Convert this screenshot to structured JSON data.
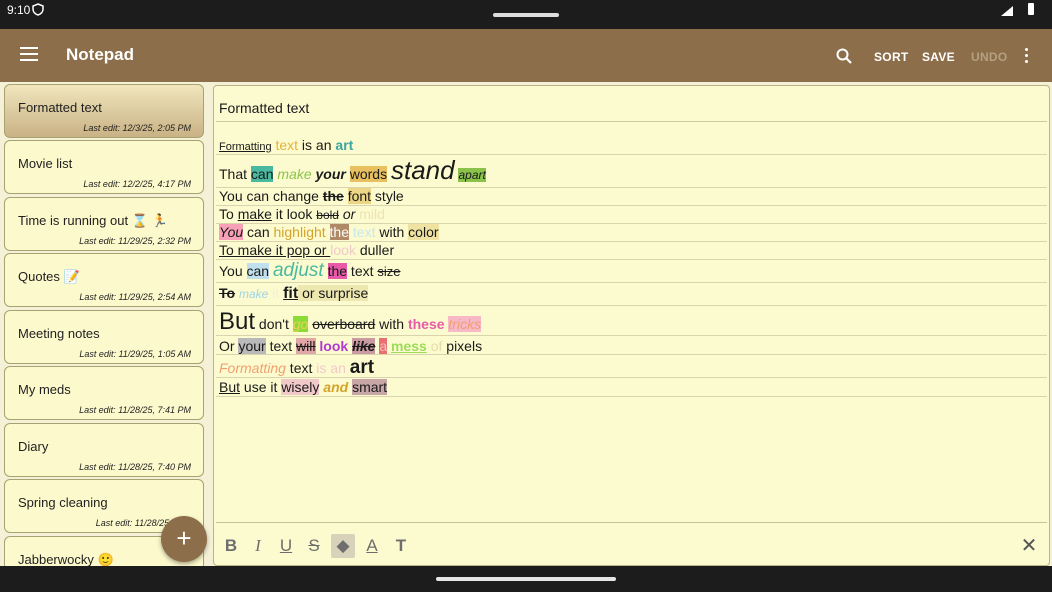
{
  "status_bar": {
    "time": "9:10"
  },
  "app_bar": {
    "title": "Notepad",
    "sort_label": "SORT",
    "save_label": "SAVE",
    "undo_label": "UNDO"
  },
  "notes": [
    {
      "name": "Formatted text",
      "date": "Last edit: 12/3/25, 2:05 PM",
      "selected": true
    },
    {
      "name": "Movie list",
      "date": "Last edit: 12/2/25, 4:17 PM"
    },
    {
      "name": "Time is running out ⌛ 🏃",
      "date": "Last edit: 11/29/25, 2:32 PM"
    },
    {
      "name": "Quotes 📝",
      "date": "Last edit: 11/29/25, 2:54 AM"
    },
    {
      "name": "Meeting notes",
      "date": "Last edit: 11/29/25, 1:05 AM"
    },
    {
      "name": "My meds",
      "date": "Last edit: 11/28/25, 7:41 PM"
    },
    {
      "name": "Diary",
      "date": "Last edit: 11/28/25, 7:40 PM"
    },
    {
      "name": "Spring cleaning",
      "date": "Last edit: 11/28/25, 11:2"
    },
    {
      "name": "Jabberwocky 🙂",
      "date": ""
    }
  ],
  "fab_label": "+",
  "editor": {
    "title": "Formatted text",
    "lines": [
      [
        "Formatting",
        " ",
        "text",
        " is an ",
        "art"
      ],
      [
        "That ",
        "can",
        " ",
        "make",
        " ",
        "your",
        " ",
        "words",
        " ",
        "stand",
        " ",
        "apart"
      ],
      [
        "You can change ",
        "the",
        " ",
        "font",
        " style"
      ],
      [
        "To ",
        "make",
        " it look ",
        "bold",
        " ",
        "or",
        " ",
        "mild"
      ],
      [
        "You",
        " can ",
        "highlight",
        " ",
        "the",
        " ",
        "text",
        " with ",
        "color"
      ],
      [
        "To make it pop or ",
        "look",
        " duller"
      ],
      [
        "You ",
        "can",
        " ",
        "adjust",
        " ",
        "the",
        " text ",
        "size"
      ],
      [
        "To",
        " ",
        "make",
        " ",
        "it",
        " ",
        "fit",
        " or surprise"
      ],
      [
        "But",
        " don't ",
        "go",
        " ",
        "overboard",
        " with ",
        "these",
        " ",
        "tricks"
      ],
      [
        "Or ",
        "your",
        " text ",
        "will",
        " ",
        "look",
        " ",
        "like",
        " ",
        "a",
        " ",
        "mess",
        " ",
        "of",
        " pixels"
      ],
      [
        "Formatting",
        " text ",
        "is an",
        " ",
        "art"
      ],
      [
        "But",
        " use it ",
        "wisely",
        " ",
        "and",
        " ",
        "smart"
      ]
    ]
  },
  "toolbar": {
    "bold": "B",
    "italic": "I",
    "underline": "U",
    "strike": "S",
    "fill": "◆",
    "color": "A",
    "size": "T",
    "close": "✕"
  },
  "colors": {
    "appbar": "#8c6e4a",
    "paper": "#fcfbd0",
    "accent": "#8c6e4a"
  }
}
